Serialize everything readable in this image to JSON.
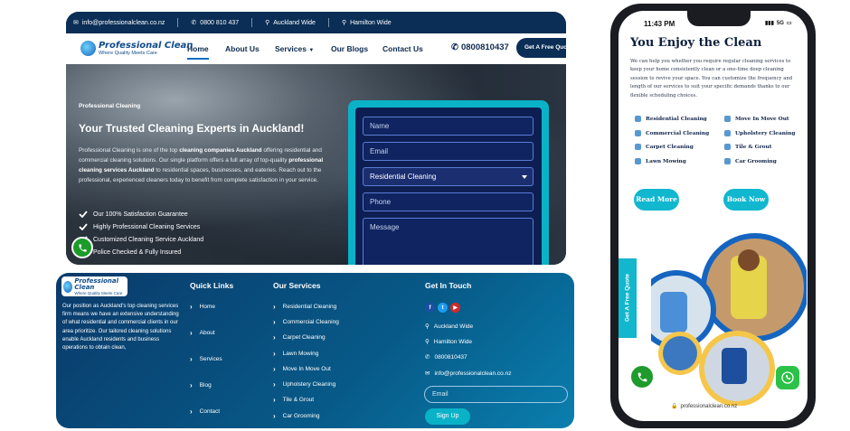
{
  "site": {
    "logo_title": "Professional Clean",
    "logo_tagline": "Where Quality Meets Care"
  },
  "topbar": {
    "email": "info@professionalclean.co.nz",
    "phone": "0800 810 437",
    "location1": "Auckland Wide",
    "location2": "Hamilton Wide"
  },
  "nav": {
    "items": [
      "Home",
      "About Us",
      "Services",
      "Our Blogs",
      "Contact Us"
    ],
    "phone": "0800810437",
    "quote_button": "Get A Free Quote"
  },
  "hero": {
    "eyebrow": "Professional Cleaning",
    "headline": "Your Trusted Cleaning Experts in Auckland!",
    "para_1": "Professional Cleaning is one of the top ",
    "para_b1": "cleaning companies Auckland",
    "para_2": " offering residential and commercial cleaning solutions. Our single platform offers a full array of top-quality ",
    "para_b2": "professional cleaning services Auckland",
    "para_3": " to residential spaces, businesses, and eateries. Reach out to the professional, experienced cleaners today to benefit from complete satisfaction in your service.",
    "checks": [
      "Our 100% Satisfaction Guarantee",
      "Highly Professional Cleaning Services",
      "Customized Cleaning Service Auckland",
      "Police Checked & Fully Insured"
    ]
  },
  "form": {
    "name_placeholder": "Name",
    "email_placeholder": "Email",
    "service_selected": "Residential Cleaning",
    "phone_placeholder": "Phone",
    "message_placeholder": "Message"
  },
  "footer": {
    "about": "Our position as Auckland's top cleaning services firm means we have an extensive understanding of what residential and commercial clients in our area prioritize. Our tailored cleaning solutions enable Auckland residents and business operations to obtain clean,",
    "quick_links_title": "Quick Links",
    "quick_links": [
      "Home",
      "About",
      "Services",
      "Blog",
      "Contact"
    ],
    "services_title": "Our Services",
    "services": [
      "Residential Cleaning",
      "Commercial Cleaning",
      "Carpet Cleaning",
      "Lawn Mowing",
      "Move In Move Out",
      "Upholstery Cleaning",
      "Tile & Grout",
      "Car Grooming"
    ],
    "touch_title": "Get In Touch",
    "contacts": [
      "Auckland Wide",
      "Hamilton Wide",
      "0800810437",
      "info@professionalclean.co.nz"
    ],
    "email_placeholder": "Email",
    "signup": "Sign Up"
  },
  "phone_mockup": {
    "time": "11:43 PM",
    "signal": "5G",
    "title": "You Enjoy the Clean",
    "paragraph": "We can help you whether you require regular cleaning services to keep your home consistently clean or a one-time deep cleaning session to revive your space. You can customize the frequency and length of our services to suit your specific demands thanks to our flexible scheduling choices.",
    "services_left": [
      "Residential Cleaning",
      "Commercial Cleaning",
      "Carpet Cleaning",
      "Lawn Mowing"
    ],
    "services_right": [
      "Move In Move Out",
      "Upholstery Cleaning",
      "Tile & Grout",
      "Car Grooming"
    ],
    "read_more": "Read More",
    "book_now": "Book Now",
    "side_tab": "Get A Free Quote",
    "url": "professionalclean.co.nz"
  },
  "colors": {
    "navy": "#0a2e56",
    "accent_cyan": "#0ab2c8",
    "form_navy": "#0d1f52",
    "call_green": "#1c9b2a"
  }
}
